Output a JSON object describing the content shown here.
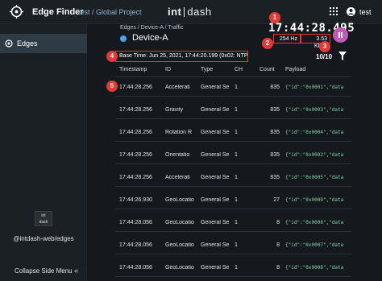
{
  "header": {
    "app_title": "Edge Finder",
    "project": "test / Global Project",
    "brand_left": "int",
    "brand_right": "dash",
    "user_name": "test"
  },
  "sidebar": {
    "items": [
      {
        "label": "Edges",
        "icon": "edges-icon"
      }
    ],
    "logo_text_top": "int",
    "logo_text_bottom": "dash",
    "link": "@intdash-web/edges",
    "collapse_label": "Collapse Side Menu",
    "collapse_icon": "«"
  },
  "main": {
    "breadcrumb": "Edges / Device-A / Traffic",
    "device_name": "Device-A",
    "device_status_color": "#4aa3ef",
    "clock": "17:44:28.495",
    "rate_hz": "254 Hz",
    "rate_kbps": "3.53 Kbps",
    "base_time": "Base Time: Jun 25, 2021, 17:44:20.199 (0x02: NTP)",
    "count_label": "10/10",
    "markers": [
      "1",
      "2",
      "3",
      "4",
      "5"
    ]
  },
  "table": {
    "headers": [
      "Timestamp",
      "ID",
      "Type",
      "CH",
      "Count",
      "Payload"
    ],
    "rows": [
      {
        "ts": "17:44:28.256",
        "id": "Accelerati",
        "type": "General Se",
        "ch": "1",
        "count": "835",
        "payload": "{\"id\":\"0x0001\",\"data"
      },
      {
        "ts": "17:44:28.256",
        "id": "Gravity",
        "type": "General Se",
        "ch": "1",
        "count": "835",
        "payload": "{\"id\":\"0x0003\",\"data"
      },
      {
        "ts": "17:44:28.256",
        "id": "Rotation R",
        "type": "General Se",
        "ch": "1",
        "count": "835",
        "payload": "{\"id\":\"0x0004\",\"data"
      },
      {
        "ts": "17:44:28.256",
        "id": "Orientatio",
        "type": "General Se",
        "ch": "1",
        "count": "835",
        "payload": "{\"id\":\"0x0002\",\"data"
      },
      {
        "ts": "17:44:28.256",
        "id": "Accelerati",
        "type": "General Se",
        "ch": "1",
        "count": "835",
        "payload": "{\"id\":\"0x0005\",\"data"
      },
      {
        "ts": "17:44:26.930",
        "id": "GeoLocatio",
        "type": "General Se",
        "ch": "1",
        "count": "27",
        "payload": "{\"id\":\"0x0009\",\"data"
      },
      {
        "ts": "17:44:28.056",
        "id": "GeoLocatio",
        "type": "General Se",
        "ch": "1",
        "count": "8",
        "payload": "{\"id\":\"0x0006\",\"data"
      },
      {
        "ts": "17:44:28.056",
        "id": "GeoLocatio",
        "type": "General Se",
        "ch": "1",
        "count": "8",
        "payload": "{\"id\":\"0x0007\",\"data"
      },
      {
        "ts": "17:44:28.056",
        "id": "GeoLocatio",
        "type": "General Se",
        "ch": "1",
        "count": "8",
        "payload": "{\"id\":\"0x0008\",\"data"
      }
    ]
  }
}
